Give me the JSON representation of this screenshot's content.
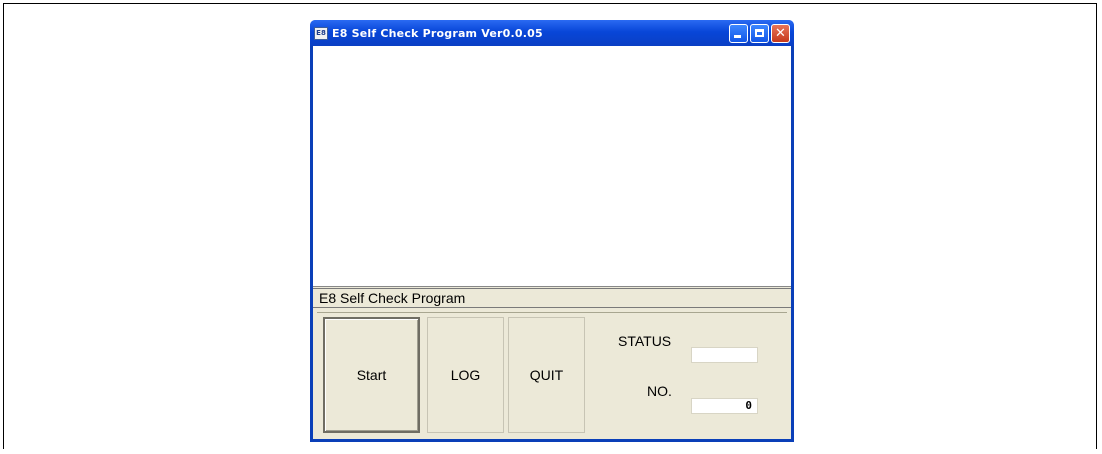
{
  "window": {
    "title": "E8 Self Check Program Ver0.0.05",
    "icon_text": "E8"
  },
  "main": {
    "section_label": "E8 Self Check Program",
    "buttons": {
      "start": "Start",
      "log": "LOG",
      "quit": "QUIT"
    },
    "status": {
      "label": "STATUS",
      "value": ""
    },
    "number": {
      "label": "NO.",
      "value": "0"
    }
  },
  "colors": {
    "title_bar": "#0846d8",
    "window_bg": "#ece9d8",
    "close_button": "#c6391b"
  }
}
